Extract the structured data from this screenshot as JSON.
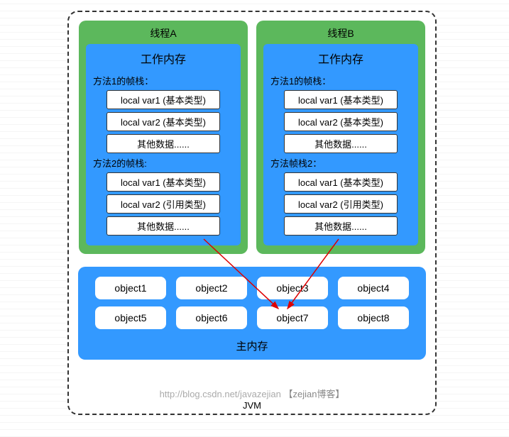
{
  "jvm": {
    "label": "JVM"
  },
  "threads": [
    {
      "title": "线程A",
      "workMemoryTitle": "工作内存",
      "frames": [
        {
          "label": "方法1的帧栈：",
          "vars": [
            "local var1 (基本类型)",
            "local var2 (基本类型)",
            "其他数据......"
          ]
        },
        {
          "label": "方法2的帧栈:",
          "vars": [
            "local var1 (基本类型)",
            "local var2 (引用类型)",
            "其他数据......"
          ]
        }
      ]
    },
    {
      "title": "线程B",
      "workMemoryTitle": "工作内存",
      "frames": [
        {
          "label": "方法1的帧栈：",
          "vars": [
            "local var1 (基本类型)",
            "local var2 (基本类型)",
            "其他数据......"
          ]
        },
        {
          "label": "方法帧栈2：",
          "vars": [
            "local var1 (基本类型)",
            "local var2 (引用类型)",
            "其他数据......"
          ]
        }
      ]
    }
  ],
  "mainMemory": {
    "title": "主内存",
    "objects": [
      "object1",
      "object2",
      "object3",
      "object4",
      "object5",
      "object6",
      "object7",
      "object8"
    ]
  },
  "footer": {
    "url": "http://blog.csdn.net/javazejian",
    "name": "【zejian博客】"
  },
  "arrows": [
    {
      "from": "threadA-localvar2-ref",
      "to": "object3"
    },
    {
      "from": "threadB-localvar2-ref",
      "to": "object3"
    }
  ]
}
